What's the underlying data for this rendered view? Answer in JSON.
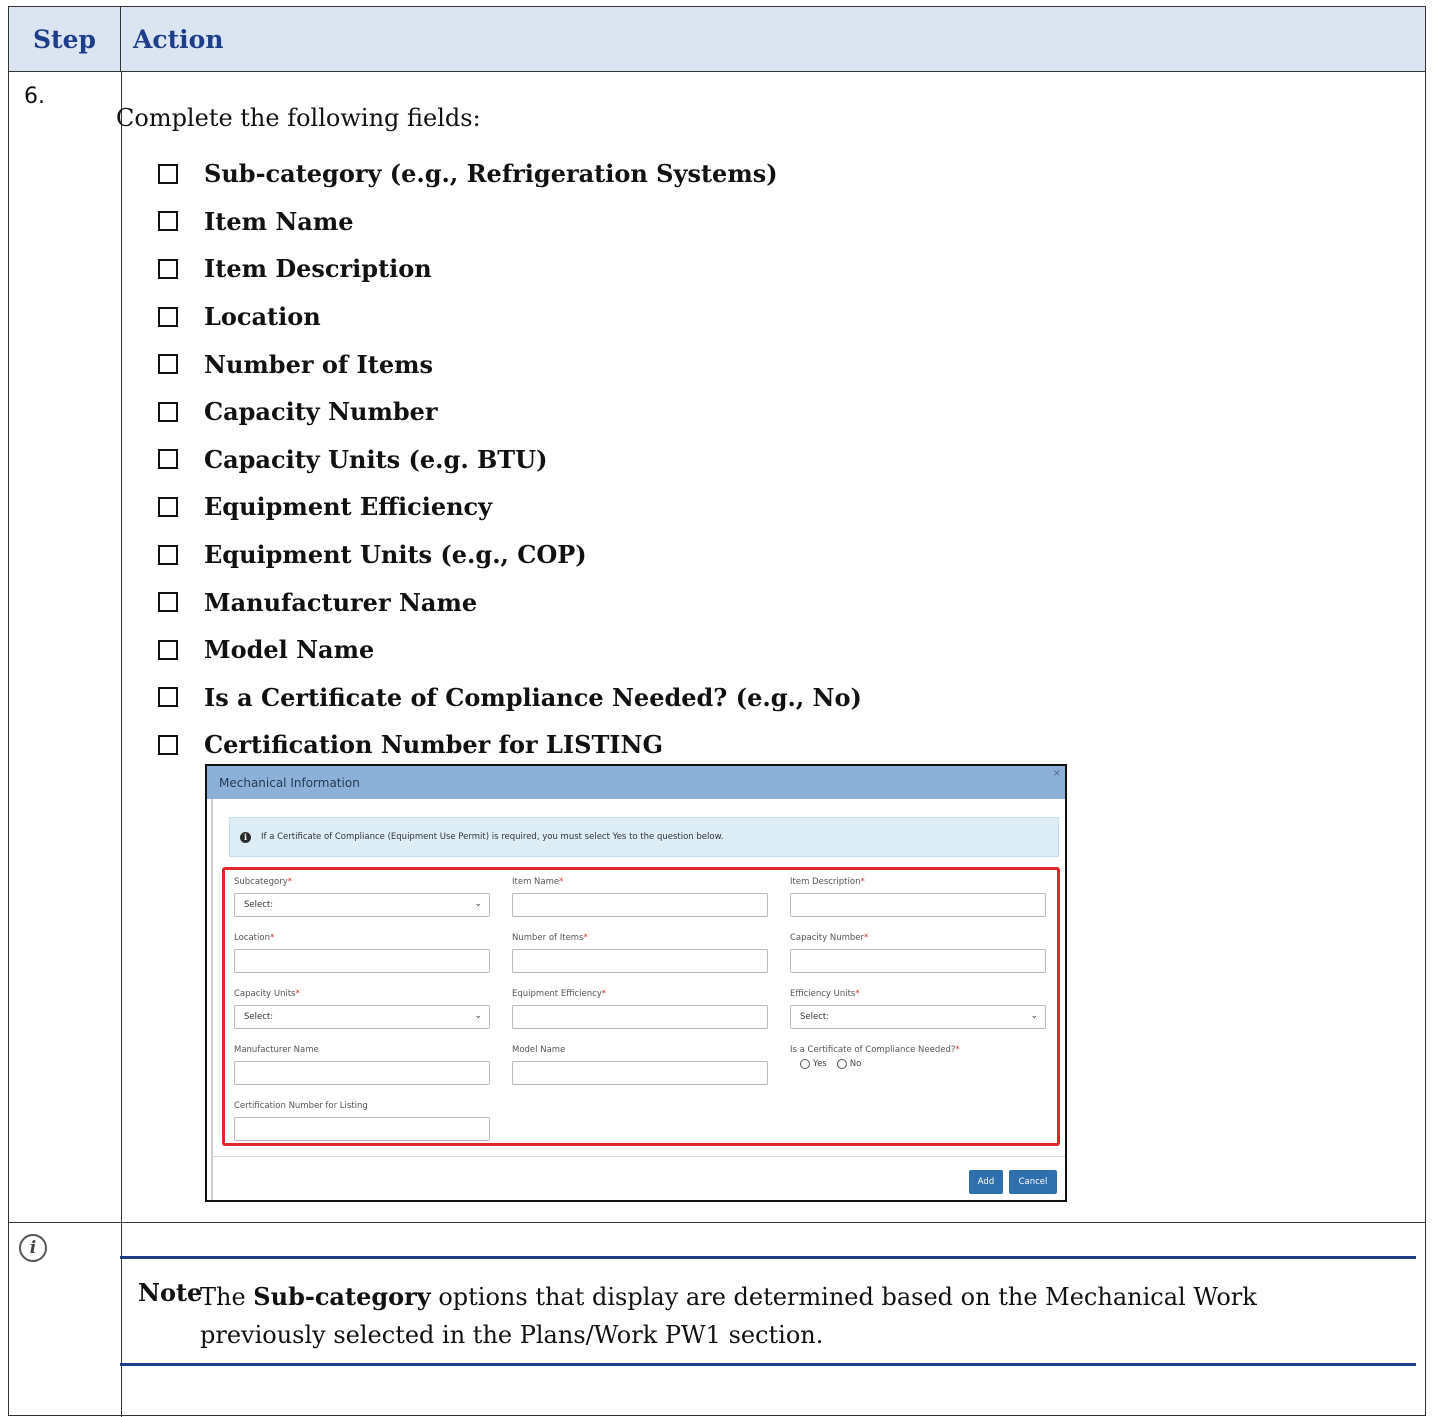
{
  "header": {
    "step": "Step",
    "action": "Action"
  },
  "step": {
    "number": "6.",
    "intro": "Complete the following fields:",
    "checklist": [
      "Sub-category (e.g., Refrigeration Systems)",
      "Item Name",
      "Item Description",
      "Location",
      "Number of Items",
      "Capacity Number",
      "Capacity Units (e.g. BTU)",
      "Equipment Efficiency",
      "Equipment Units (e.g., COP)",
      "Manufacturer Name",
      "Model Name",
      "Is a Certificate of Compliance Needed? (e.g., No)",
      "Certification Number for LISTING"
    ]
  },
  "dialog": {
    "title": "Mechanical Information",
    "close": "×",
    "alert": "If a Certificate of Compliance (Equipment Use Permit) is required, you must select Yes to the question below.",
    "alert_icon": "info-icon",
    "required_marker": "*",
    "fields": {
      "subcategory": {
        "label": "Subcategory",
        "value": "Select:"
      },
      "item_name": {
        "label": "Item Name"
      },
      "item_description": {
        "label": "Item Description"
      },
      "location": {
        "label": "Location"
      },
      "number_of_items": {
        "label": "Number of Items"
      },
      "capacity_number": {
        "label": "Capacity Number"
      },
      "capacity_units": {
        "label": "Capacity Units",
        "value": "Select:"
      },
      "equipment_efficiency": {
        "label": "Equipment Efficiency"
      },
      "efficiency_units": {
        "label": "Efficiency Units",
        "value": "Select:"
      },
      "manufacturer_name": {
        "label": "Manufacturer Name"
      },
      "model_name": {
        "label": "Model Name"
      },
      "coc_needed": {
        "label": "Is a Certificate of Compliance Needed?",
        "yes": "Yes",
        "no": "No"
      },
      "certification_number": {
        "label": "Certification Number for Listing"
      }
    },
    "buttons": {
      "add": "Add",
      "cancel": "Cancel"
    },
    "colors": {
      "title_bar": "#8cb0d8",
      "highlight": "#e0262b",
      "button": "#2f6fad",
      "alert_bg": "#dcedf5"
    }
  },
  "note": {
    "icon": "info-icon",
    "tag": "Note",
    "text_before": "The ",
    "text_bold": "Sub-category",
    "text_after": " options that display are determined based on the Mechanical Work previously selected in the Plans/Work PW1 section."
  },
  "colors": {
    "header_bg": "#dbe5f1",
    "heading_text": "#1f3e8a",
    "note_rule": "#1f3e8a"
  }
}
